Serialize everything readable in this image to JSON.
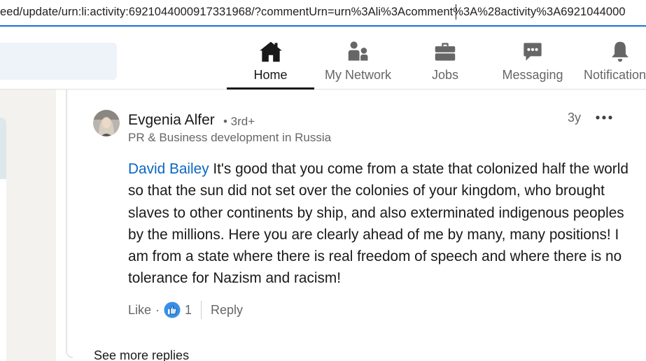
{
  "browser": {
    "url": "eed/update/urn:li:activity:6921044000917331968/?commentUrn=urn%3Ali%3Acomment%3A%28activity%3A6921044000"
  },
  "nav": {
    "items": [
      {
        "label": "Home",
        "icon": "home-icon",
        "active": true
      },
      {
        "label": "My Network",
        "icon": "network-icon"
      },
      {
        "label": "Jobs",
        "icon": "briefcase-icon"
      },
      {
        "label": "Messaging",
        "icon": "messaging-icon"
      },
      {
        "label": "Notifications",
        "icon": "bell-icon"
      }
    ]
  },
  "comment": {
    "author": "Evgenia Alfer",
    "degree": "• 3rd+",
    "headline": "PR & Business development in Russia",
    "time": "3y",
    "mention": "David Bailey",
    "text": " It's good that you come from a state that colonized half the world so that the sun did not set over the colonies of your kingdom, who brought slaves to other continents by ship, and also exterminated indigenous peoples by the millions. Here you are clearly ahead of me by many, many positions! I am from a state where there is real freedom of speech and where there is no tolerance for Nazism and racism!",
    "actions": {
      "like": "Like",
      "dot": "·",
      "reaction_count": "1",
      "reply": "Reply"
    }
  },
  "thread": {
    "see_more": "See more replies"
  },
  "colors": {
    "link": "#0a66c2",
    "url_focus": "#1a73e8",
    "nav_active": "#191919",
    "muted": "#666666"
  }
}
